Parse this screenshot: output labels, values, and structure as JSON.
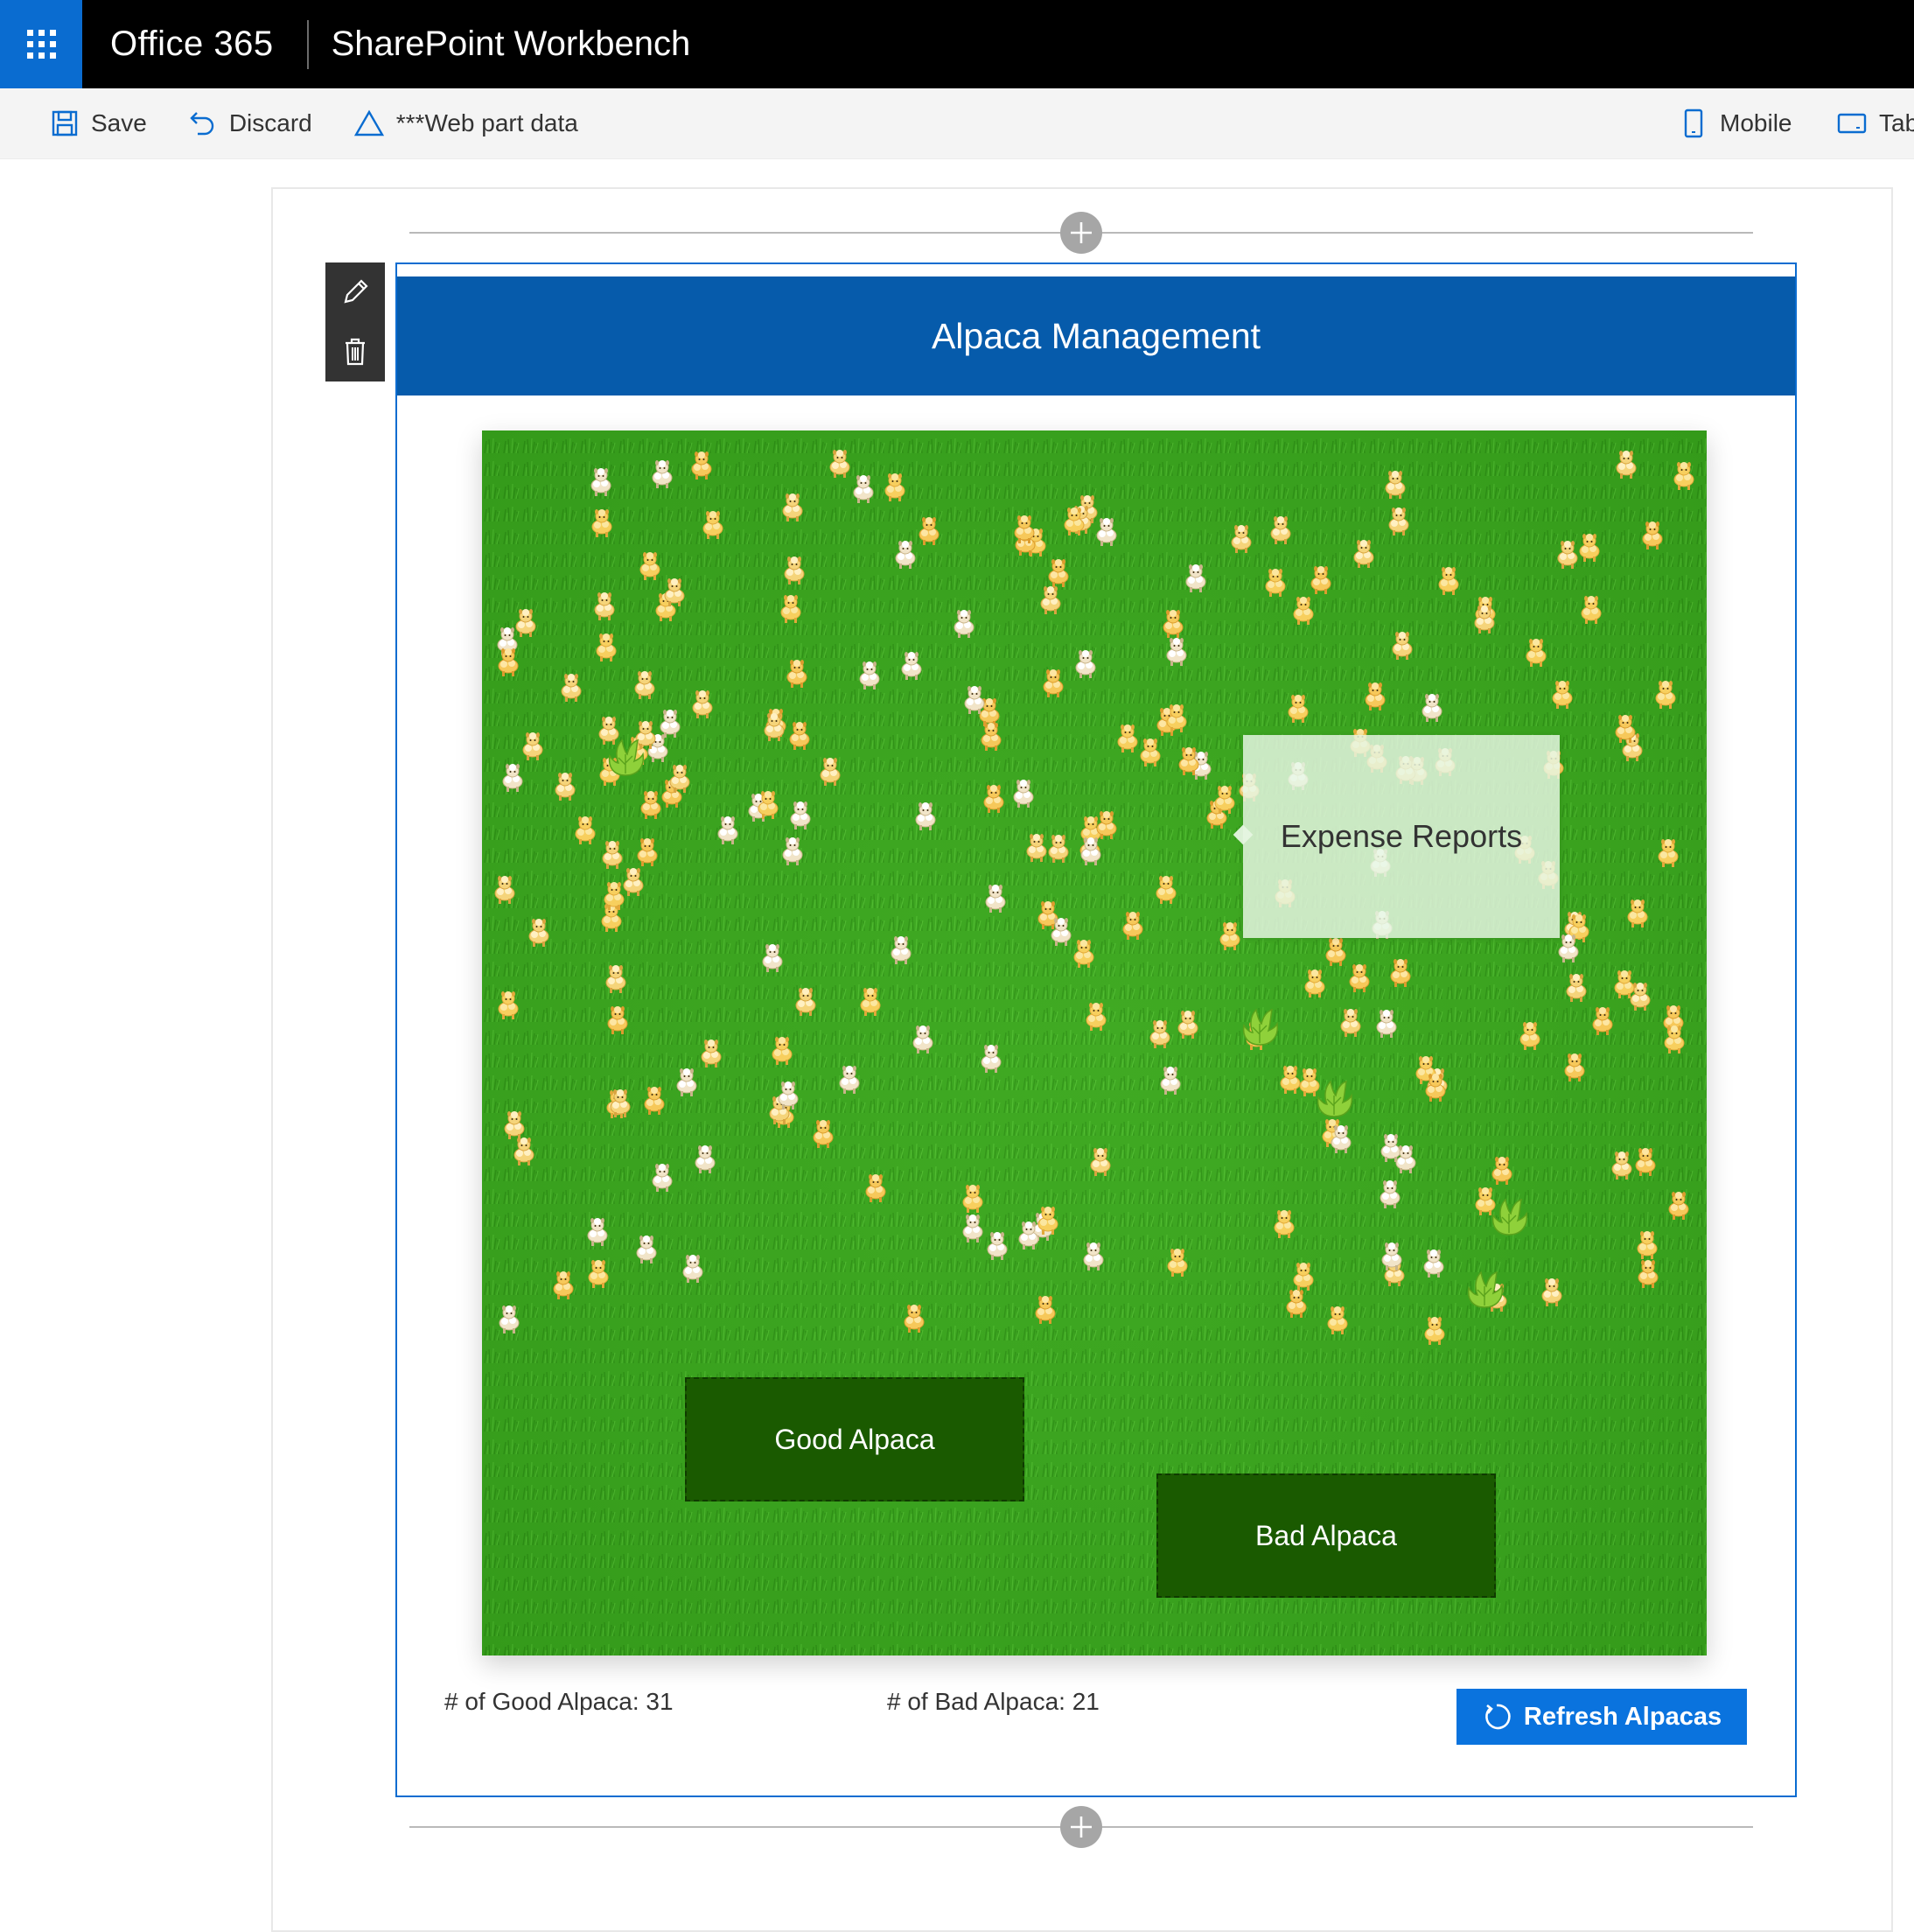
{
  "suite_bar": {
    "brand": "Office 365",
    "title": "SharePoint Workbench",
    "colors": {
      "background": "#000000",
      "waffle": "#0a6cd0"
    },
    "waffle_icon": "app-launcher-icon"
  },
  "command_bar": {
    "save_label": "Save",
    "discard_label": "Discard",
    "webpart_data_label": "***Web part data",
    "mobile_label": "Mobile",
    "tablet_label": "Tab",
    "icons": [
      "save-icon",
      "undo-icon",
      "warning-icon",
      "mobile-icon",
      "tablet-icon"
    ]
  },
  "canvas": {
    "add_section_icon": "plus-circle-icon"
  },
  "web_part_toolbar": {
    "icons": [
      "pencil-icon",
      "trash-icon"
    ]
  },
  "web_part": {
    "header_title": "Alpaca Management",
    "header_color": "#065bab",
    "tooltip_text": "Expense Reports",
    "good_zone_label": "Good Alpaca",
    "bad_zone_label": "Bad Alpaca",
    "good_count_text": "# of Good Alpaca: 31",
    "bad_count_text": "# of Bad Alpaca: 21",
    "refresh_label": "Refresh Alpacas",
    "refresh_color": "#0a73de",
    "refresh_icon": "refresh-icon",
    "pasture_color": "#3aa31e"
  }
}
